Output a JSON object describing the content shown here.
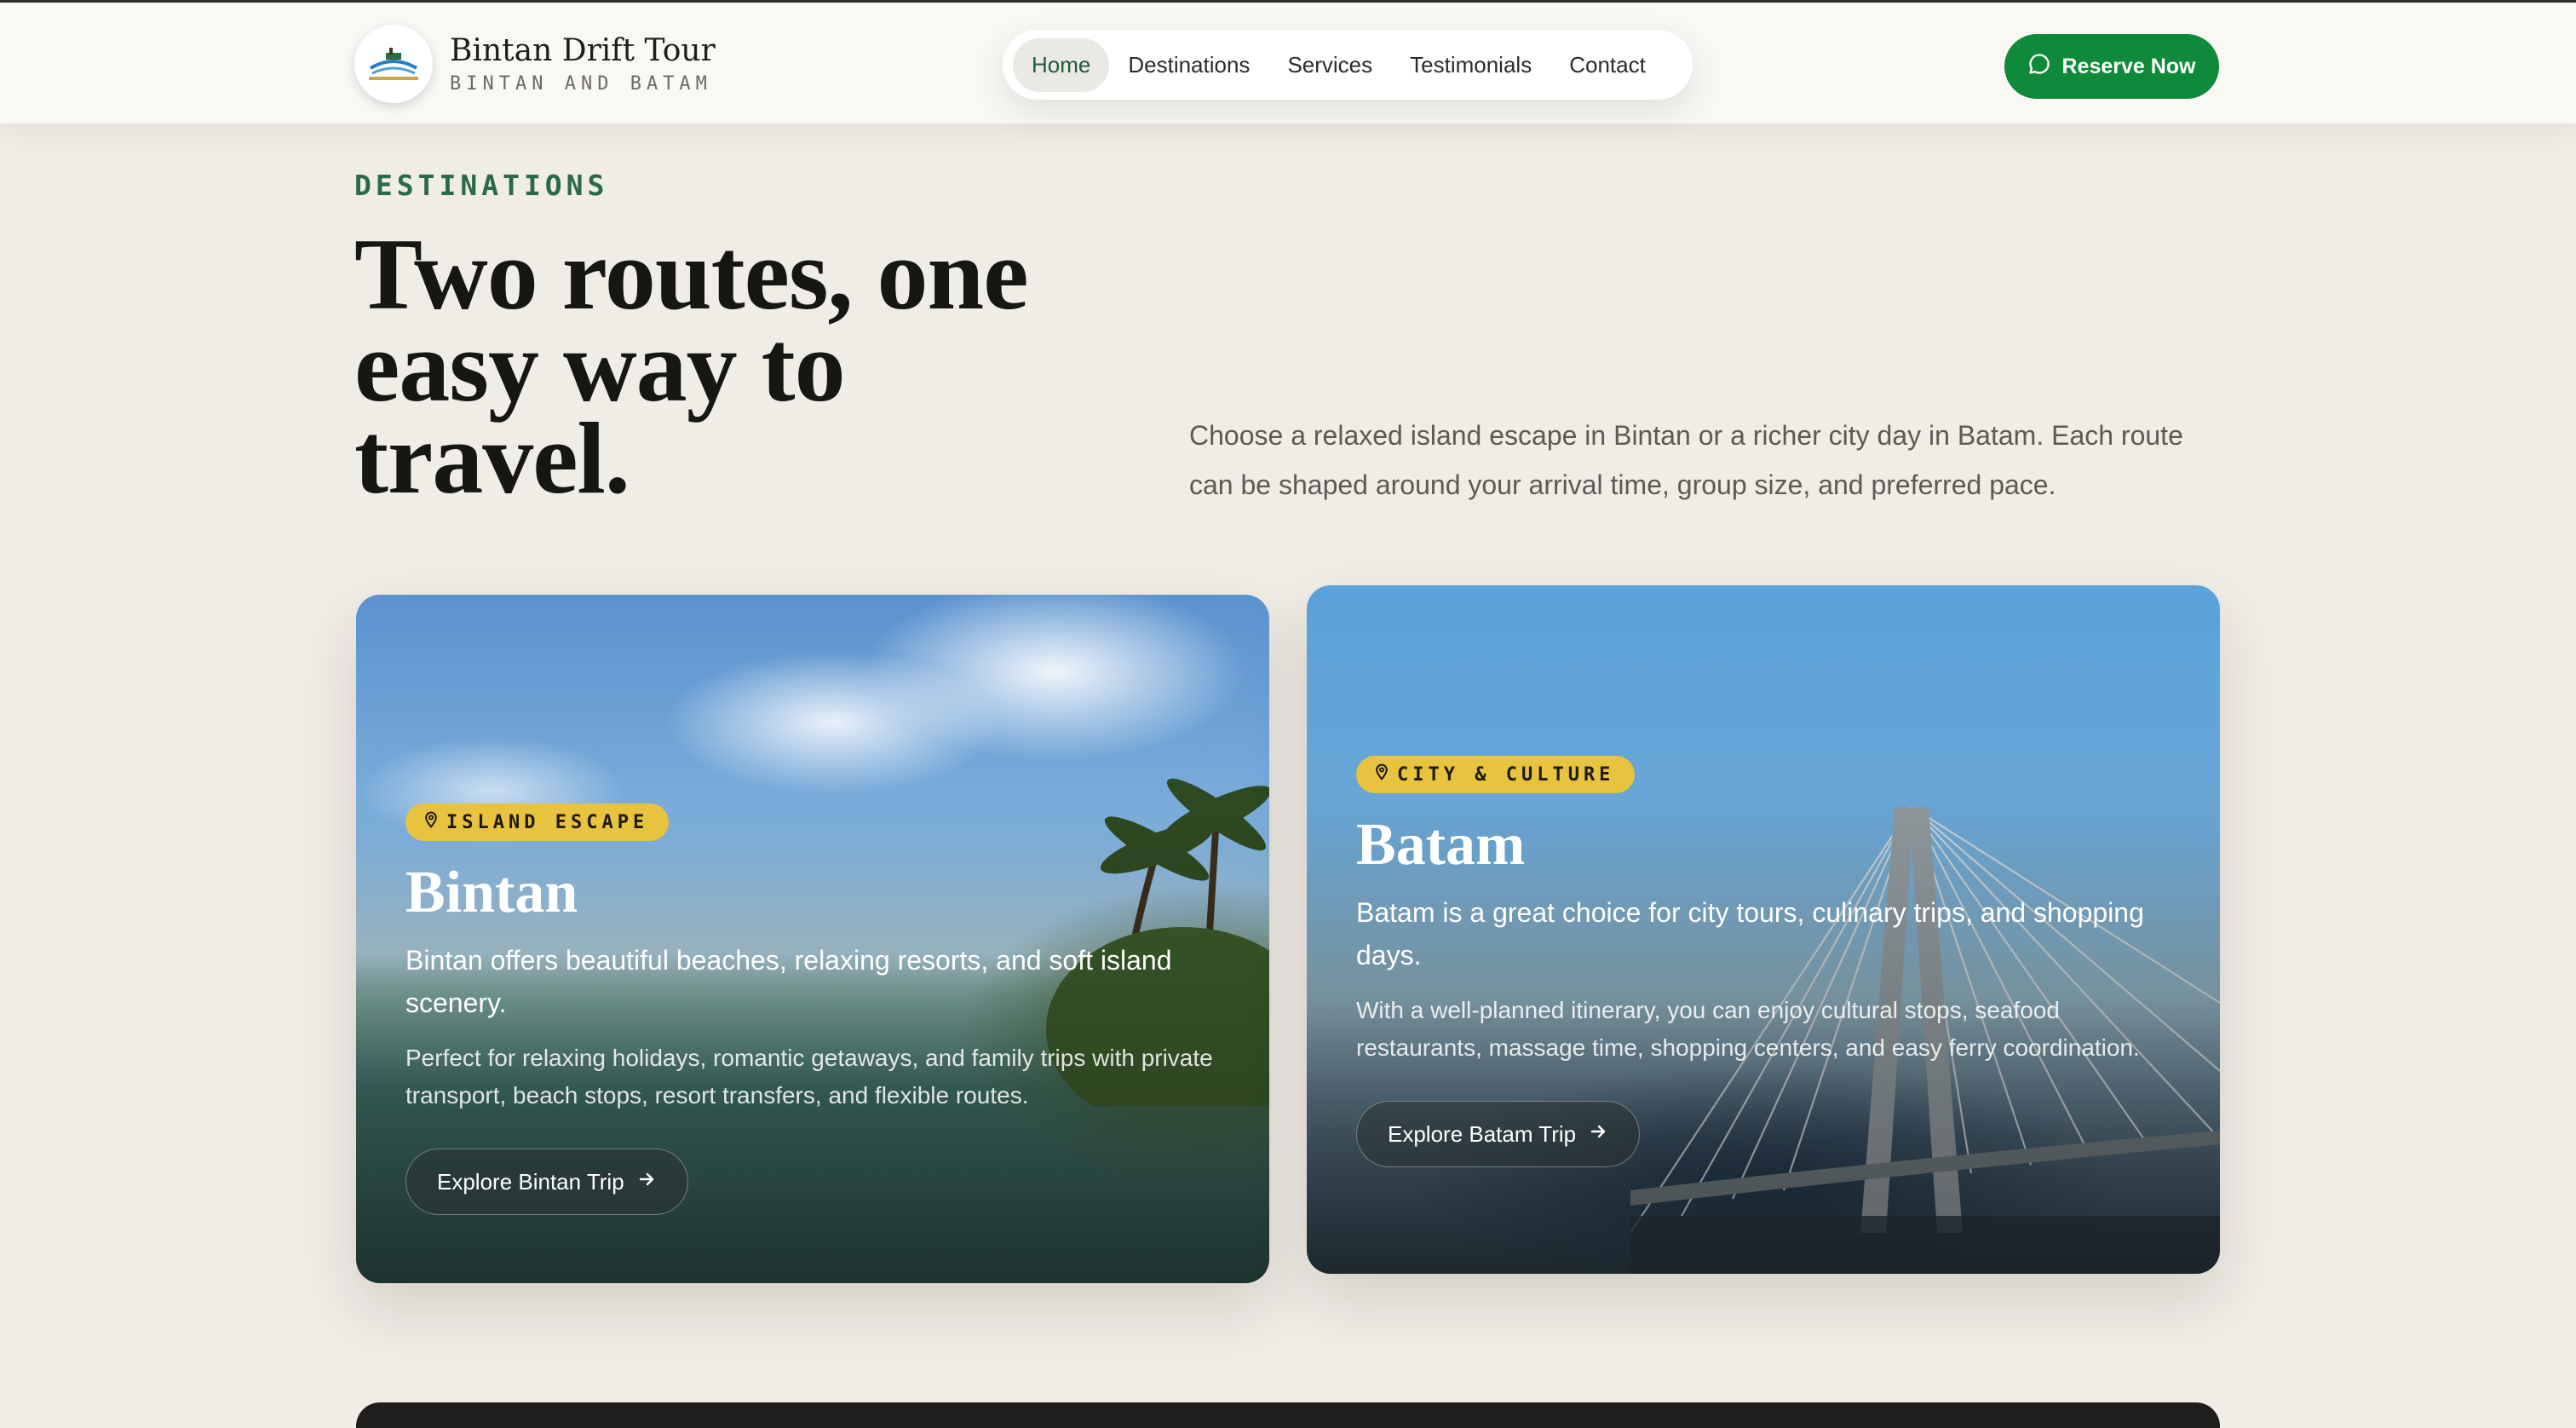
{
  "brand": {
    "title": "Bintan Drift Tour",
    "subtitle": "BINTAN AND BATAM"
  },
  "nav": {
    "items": [
      {
        "label": "Home",
        "active": true
      },
      {
        "label": "Destinations"
      },
      {
        "label": "Services"
      },
      {
        "label": "Testimonials"
      },
      {
        "label": "Contact"
      }
    ],
    "cta": "Reserve Now",
    "cta_icon": "chat-bubble-icon"
  },
  "section": {
    "eyebrow": "DESTINATIONS",
    "headline": "Two routes, one easy way to travel.",
    "intro": "Choose a relaxed island escape in Bintan or a richer city day in Batam. Each route can be shaped around your arrival time, group size, and preferred pace."
  },
  "cards": [
    {
      "badge": "ISLAND ESCAPE",
      "title": "Bintan",
      "lead": "Bintan offers beautiful beaches, relaxing resorts, and soft island scenery.",
      "desc": "Perfect for relaxing holidays, romantic getaways, and family trips with private transport, beach stops, resort transfers, and flexible routes.",
      "button": "Explore Bintan Trip"
    },
    {
      "badge": "CITY & CULTURE",
      "title": "Batam",
      "lead": "Batam is a great choice for city tours, culinary trips, and shopping days.",
      "desc": "With a well-planned itinerary, you can enjoy cultural stops, seafood restaurants, massage time, shopping centers, and easy ferry coordination.",
      "button": "Explore Batam Trip"
    }
  ],
  "colors": {
    "accent": "#0f8a3a",
    "badge": "#e8c33f",
    "eyebrow": "#2a6a48",
    "background": "#f0ece6"
  }
}
